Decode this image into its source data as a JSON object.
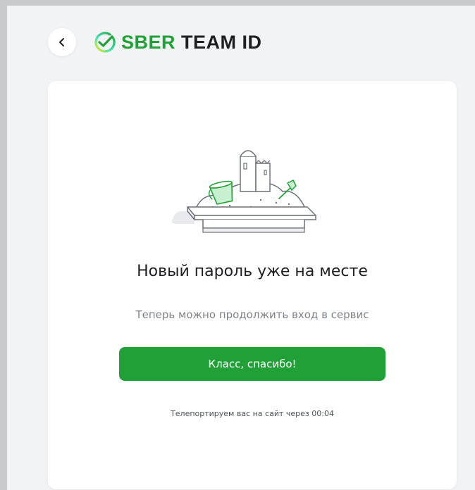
{
  "header": {
    "logo_sber": "SBER",
    "logo_rest": "TEAM ID"
  },
  "card": {
    "title": "Новый пароль уже на месте",
    "subtitle": "Теперь можно продолжить вход в сервис",
    "button_label": "Класс, спасибо!",
    "countdown": "Телепортируем вас на сайт через 00:04"
  },
  "colors": {
    "brand_green": "#21a038",
    "background": "#f2f3f5",
    "card": "#ffffff"
  },
  "icons": {
    "back": "chevron-left-icon",
    "logo": "sber-check-circle-icon",
    "illustration": "sandbox-illustration"
  }
}
